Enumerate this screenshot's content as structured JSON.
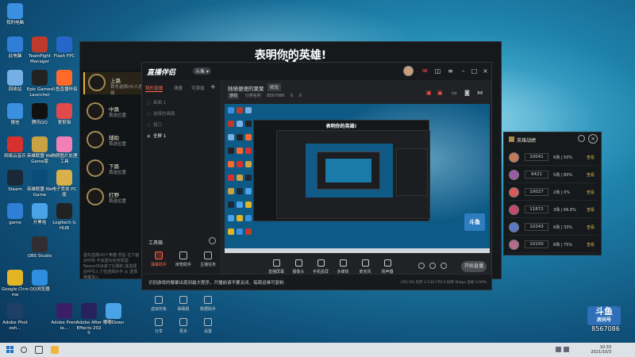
{
  "desktop": {
    "icons": [
      {
        "label": "我的电脑",
        "color": "#3b8fe0"
      },
      {
        "label": "此电脑",
        "color": "#2f7fd6"
      },
      {
        "label": "TeamFight Manager",
        "color": "#c03a2b"
      },
      {
        "label": "Flash FPC",
        "color": "#2766c9"
      },
      {
        "label": "回收站",
        "color": "#76aee6"
      },
      {
        "label": "Epic Games Launcher",
        "color": "#222222"
      },
      {
        "label": "斗鱼直播伴侣",
        "color": "#ff6a2a"
      },
      {
        "label": "微信",
        "color": "#3b8fe0"
      },
      {
        "label": "腾讯QQ",
        "color": "#111111"
      },
      {
        "label": "爱剪辑",
        "color": "#e04a4a"
      },
      {
        "label": "网易云音乐",
        "color": "#d8302e"
      },
      {
        "label": "英雄联盟 WeGame版",
        "color": "#c9a243"
      },
      {
        "label": "狗爬图片处理工具",
        "color": "#f27fb5"
      },
      {
        "label": "Steam",
        "color": "#1b2838"
      },
      {
        "label": "英雄联盟 WeGame",
        "color": "#0a4c7a"
      },
      {
        "label": "电子竞技 PC版",
        "color": "#d8b14a"
      },
      {
        "label": "game",
        "color": "#2f7fd6"
      },
      {
        "label": "开黑啦",
        "color": "#4aa3e6"
      },
      {
        "label": "Logitech G HUB",
        "color": "#222222"
      },
      {
        "label": "OBS Studio",
        "color": "#302e31"
      },
      {
        "label": "Google Chrome",
        "color": "#e4b427"
      },
      {
        "label": "QQ浏览器",
        "color": "#2f8ee0"
      },
      {
        "label": "Adobe Photosh...",
        "color": "#1f3f66"
      },
      {
        "label": "Adobe Premie...",
        "color": "#3b1f66"
      },
      {
        "label": "Adobe After Effects 2020",
        "color": "#27215e"
      },
      {
        "label": "嘟嘟Down",
        "color": "#4aa3e6"
      }
    ]
  },
  "game": {
    "title": "表明你的英雄!",
    "number": "14",
    "roles": [
      {
        "name": "上路",
        "sub": "首先选择(4)人选择"
      },
      {
        "name": "中路",
        "sub": "首选位置"
      },
      {
        "name": "辅助",
        "sub": "首选位置"
      },
      {
        "name": "下路",
        "sub": "首选位置"
      },
      {
        "name": "打野",
        "sub": "首选位置"
      }
    ],
    "description": "首先选择(4)个英雄 然后 在下面对中你 不会因为任何原因 Nexon中出来了比赛的 其选择后中引入了任选择外不 从 选择英雄加入"
  },
  "app": {
    "logo": "直播伴侣",
    "version": "斗鱼 ▾",
    "tabs": [
      "我的直播",
      "场景",
      "可添加"
    ],
    "scenes": [
      {
        "label": "画面 1",
        "on": false
      },
      {
        "label": "选择的画面",
        "on": false
      },
      {
        "label": "窗口",
        "on": false
      },
      {
        "label": "全屏 1",
        "on": true
      }
    ],
    "tools_title": "工具箱",
    "tools": [
      {
        "label": "弹幕助手",
        "red": true
      },
      {
        "label": "房管助手",
        "red": false
      },
      {
        "label": "主播任务",
        "red": false
      },
      {
        "label": "视频合集",
        "red": false
      },
      {
        "label": "礼物设置",
        "red": false
      },
      {
        "label": "录制回放",
        "red": false
      },
      {
        "label": "虚拟形象",
        "red": false
      },
      {
        "label": "弹幕姬",
        "red": false
      },
      {
        "label": "数据助手",
        "red": false
      },
      {
        "label": "分享",
        "red": false
      },
      {
        "label": "更多",
        "red": false
      },
      {
        "label": "设置",
        "red": false
      }
    ],
    "room_title": "随随便便的聚聚",
    "room_tag": "修改",
    "info": {
      "category": "游戏",
      "room_label": "分类名称",
      "room_id": "8567086",
      "likes": "0",
      "fans": "0"
    },
    "preview": {
      "nested_title": "表明你的英雄!",
      "watermark_logo": "斗鱼"
    },
    "controls": [
      "直播屏幕",
      "摄像头",
      "手机投屏",
      "多媒体",
      "麦克风",
      "扬声器"
    ],
    "start_label": "开始直播",
    "status_msg": "识别游戏的聚聚出现到最大程序，开播前请不要关闭、每周运维可复制",
    "status_stats": "CPU 0%  内存 2.13G  FPS 0  码率 0kbps  丢帧 0.00%"
  },
  "score_panel": {
    "title": "英雄战绩",
    "rows": [
      {
        "points": "10041",
        "rate": "6场 | 50%",
        "action": "查看",
        "color": "#c47a5a"
      },
      {
        "points": "9421",
        "rate": "5场 | 80%",
        "action": "查看",
        "color": "#9a5aa6"
      },
      {
        "points": "10027",
        "rate": "2场 | 0%",
        "action": "查看",
        "color": "#d85a5a"
      },
      {
        "points": "11872",
        "rate": "3场 | 66.6%",
        "action": "查看",
        "color": "#c44a6a"
      },
      {
        "points": "10243",
        "rate": "6场 | 33%",
        "action": "查看",
        "color": "#5a7ac4"
      },
      {
        "points": "10150",
        "rate": "8场 | 75%",
        "action": "查看",
        "color": "#b46a8a"
      }
    ]
  },
  "watermark": {
    "logo": "斗鱼",
    "sub": "房间号",
    "room": "8567086"
  },
  "taskbar": {
    "time": "10:33",
    "date": "2021/10/3",
    "apps": [
      "search-icon",
      "task-view-icon",
      "explorer-icon",
      "app-icon"
    ]
  }
}
